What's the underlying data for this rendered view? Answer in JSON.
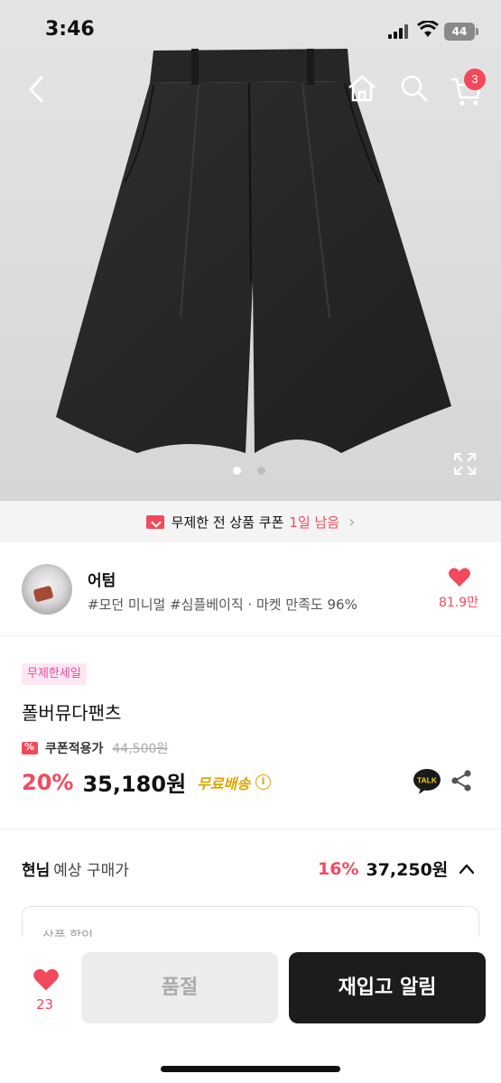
{
  "status_bar": {
    "time": "3:46",
    "battery": "44"
  },
  "header": {
    "cart_count": "3"
  },
  "gallery": {
    "page_count": 2,
    "active_index": 0
  },
  "coupon_banner": {
    "text": "무제한 전 상품 쿠폰",
    "highlight": "1일 남음"
  },
  "shop": {
    "name": "어텀",
    "tags": "#모던 미니멀 #심플베이직 · 마켓 만족도 96%",
    "likes": "81.9만"
  },
  "product": {
    "badge": "무제한세일",
    "name": "폴버뮤다팬츠",
    "coupon_label": "쿠폰적용가",
    "original_price": "44,500원",
    "discount": "20%",
    "price": "35,180원",
    "shipping": "무료배송"
  },
  "expected": {
    "who": "현님",
    "label": "예상 구매가",
    "discount": "16%",
    "price": "37,250원",
    "detail_label": "상품 할인"
  },
  "bottom_bar": {
    "wish_count": "23",
    "soldout_label": "품절",
    "restock_label": "재입고 알림"
  },
  "colors": {
    "accent": "#f24a5c",
    "shipping": "#e0a400",
    "badge_text": "#e24da0",
    "dark_button": "#1c1c1c"
  }
}
